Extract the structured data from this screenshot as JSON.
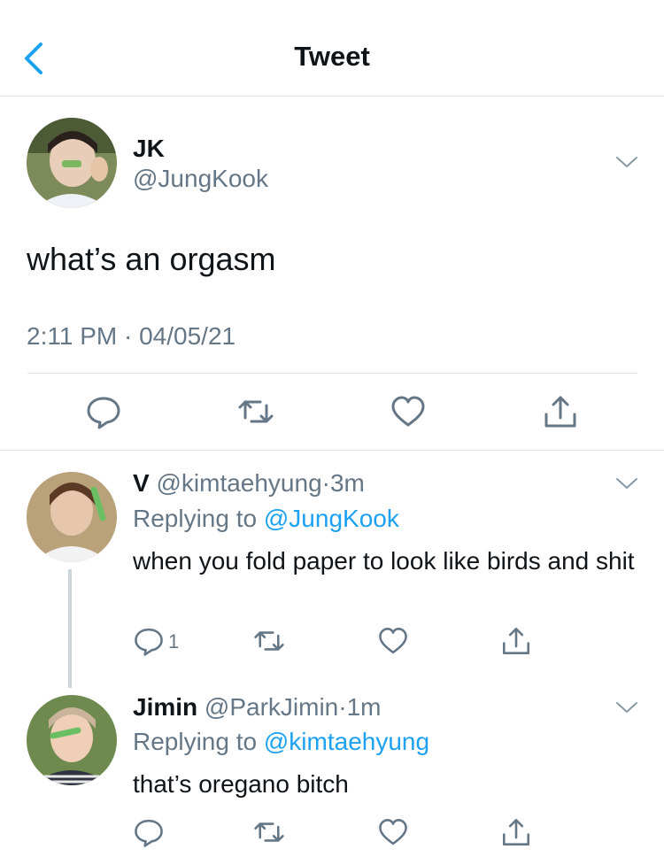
{
  "header": {
    "title": "Tweet"
  },
  "main_tweet": {
    "name": "JK",
    "handle": "@JungKook",
    "text": "what’s an orgasm",
    "time": "2:11 PM",
    "date": "04/05/21",
    "separator": "·"
  },
  "replies": [
    {
      "name": "V",
      "handle": "@kimtaehyung",
      "sep": "·",
      "time": "3m",
      "replying_label": "Replying to",
      "replying_to": "@JungKook",
      "text": "when you fold paper to look like birds and shit",
      "reply_count": "1"
    },
    {
      "name": "Jimin",
      "handle": "@ParkJimin",
      "sep": "·",
      "time": "1m",
      "replying_label": "Replying to",
      "replying_to": "@kimtaehyung",
      "text": "that’s oregano bitch",
      "reply_count": ""
    }
  ],
  "icons": [
    "back-icon",
    "chevron-down-icon",
    "reply-icon",
    "retweet-icon",
    "like-icon",
    "share-icon"
  ],
  "colors": {
    "accent": "#1da1f2",
    "muted": "#657786",
    "text": "#0f1419",
    "divider": "#e1e4e8"
  }
}
